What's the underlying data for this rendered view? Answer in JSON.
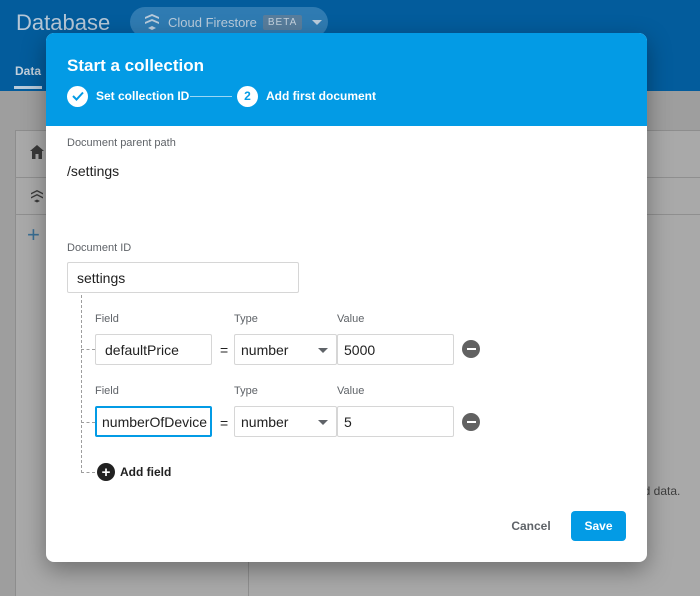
{
  "app": {
    "title": "Database",
    "product": "Cloud Firestore",
    "badge": "BETA",
    "tab": "Data",
    "hint": "ld data."
  },
  "dialog": {
    "title": "Start a collection",
    "steps": [
      {
        "label": "Set collection ID",
        "state": "done"
      },
      {
        "label": "Add first document",
        "number": "2",
        "state": "active"
      }
    ],
    "parent_path_label": "Document parent path",
    "parent_path": "/settings",
    "doc_id_label": "Document ID",
    "doc_id": "settings",
    "fields": [
      {
        "field_label": "Field",
        "type_label": "Type",
        "value_label": "Value",
        "field": "defaultPrice",
        "equals": "=",
        "type": "number",
        "value": "5000"
      },
      {
        "field_label": "Field",
        "type_label": "Type",
        "value_label": "Value",
        "field": "numberOfDevice",
        "equals": "=",
        "type": "number",
        "value": "5"
      }
    ],
    "add_field": "Add field",
    "cancel": "Cancel",
    "save": "Save"
  },
  "colors": {
    "accent": "#039be5",
    "header_bg": "#035c9c"
  }
}
